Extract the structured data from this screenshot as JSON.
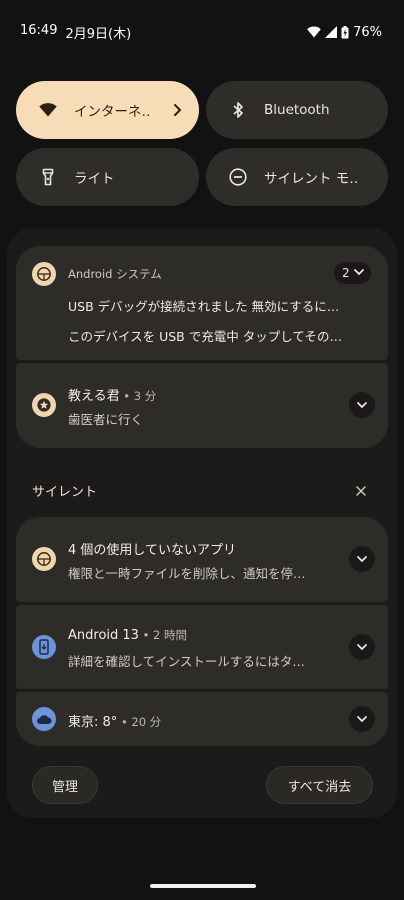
{
  "status_bar": {
    "time": "16:49",
    "date": "2月9日(木)",
    "battery": "76%"
  },
  "quick_settings": {
    "tiles": [
      {
        "label": "インターネ‥",
        "icon": "wifi-icon",
        "active": true
      },
      {
        "label": "Bluetooth",
        "icon": "bluetooth-icon",
        "active": false
      },
      {
        "label": "ライト",
        "icon": "flashlight-icon",
        "active": false
      },
      {
        "label": "サイレント モ‥",
        "icon": "do-not-disturb-icon",
        "active": false
      }
    ]
  },
  "notifications": {
    "group": {
      "app_name": "Android システム",
      "count": "2",
      "lines": [
        "USB デバッグが接続されました 無効にするに…",
        "このデバイスを USB で充電中 タップしてその…"
      ]
    },
    "reminder": {
      "title": "教える君",
      "time": " • 3 分",
      "text": "歯医者に行く"
    }
  },
  "silent_section": {
    "label": "サイレント",
    "items": [
      {
        "title": "4 個の使用していないアプリ",
        "time": "",
        "text": "権限と一時ファイルを削除し、通知を停…"
      },
      {
        "title": "Android 13",
        "time": " • 2 時間",
        "text": "詳細を確認してインストールするにはタ…"
      },
      {
        "title": "東京: 8°",
        "time": " • 20 分",
        "text": ""
      }
    ]
  },
  "footer": {
    "manage_label": "管理",
    "clear_all_label": "すべて消去"
  },
  "colors": {
    "background": "#121212",
    "accent_tile": "#f7dcb8",
    "card": "#2e2c29",
    "weather_icon": "#6d93d8"
  }
}
